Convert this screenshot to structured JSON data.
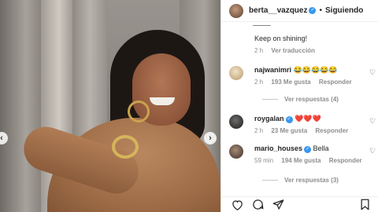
{
  "post": {
    "carousel": {
      "prev_glyph": "‹",
      "next_glyph": "›"
    }
  },
  "header": {
    "username": "berta__vazquez",
    "separator": "•",
    "follow_label": "Siguiendo",
    "verified": true
  },
  "caption": {
    "text": "Keep on shining!",
    "time": "2 h",
    "translate_label": "Ver traducción"
  },
  "comments": [
    {
      "username": "najwanimri",
      "text": "😂😂😂😂😂",
      "time": "2 h",
      "likes": "193 Me gusta",
      "reply_label": "Responder",
      "replies_label": "Ver respuestas (4)",
      "verified": false
    },
    {
      "username": "roygalan",
      "text": "❤️❤️❤️",
      "time": "2 h",
      "likes": "23 Me gusta",
      "reply_label": "Responder",
      "verified": true
    },
    {
      "username": "mario_houses",
      "text": "Bella",
      "time": "59 min",
      "likes": "194 Me gusta",
      "reply_label": "Responder",
      "replies_label": "Ver respuestas (3)",
      "verified": true
    }
  ],
  "icons": {
    "heart": "heart-icon",
    "comment": "comment-icon",
    "share": "share-icon",
    "save": "bookmark-icon"
  },
  "colors": {
    "verified": "#3897f0",
    "muted_text": "#8e8e8e",
    "text": "#262626"
  }
}
